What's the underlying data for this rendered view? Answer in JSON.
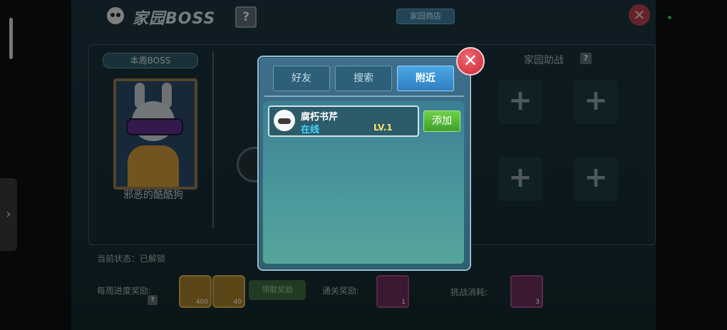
{
  "header": {
    "title": "家园BOSS",
    "help_label": "?",
    "shop_label": "家园商店",
    "close_label": "✕"
  },
  "boss_panel": {
    "tag": "本周BOSS",
    "name": "邪恶的酷酷狗"
  },
  "helpers": {
    "title": "家园助战",
    "help_label": "?",
    "slot_label": "+"
  },
  "bottom": {
    "status_label": "当前状态：已解锁",
    "weekly_label": "每周进度奖励:",
    "small_help": "?",
    "coin1_count": "400",
    "coin2_count": "40",
    "claim_label": "领取奖励",
    "clear_label": "通关奖励:",
    "clear_item_count": "1",
    "cost_label": "挑战消耗:",
    "cost_item_count": "3"
  },
  "modal": {
    "tabs": [
      "好友",
      "搜索",
      "附近"
    ],
    "active_tab": "附近",
    "close_label": "✕",
    "friend": {
      "name": "腐朽书芹",
      "status": "在线",
      "level": "LV.1",
      "add_label": "添加"
    }
  },
  "system": {
    "side_handle": "›"
  },
  "colors": {
    "active_tab": "#2f7fc1",
    "online_status": "#42d3ff",
    "level": "#ffe066",
    "add_button": "#3f9f2a",
    "close": "#d63a47"
  }
}
